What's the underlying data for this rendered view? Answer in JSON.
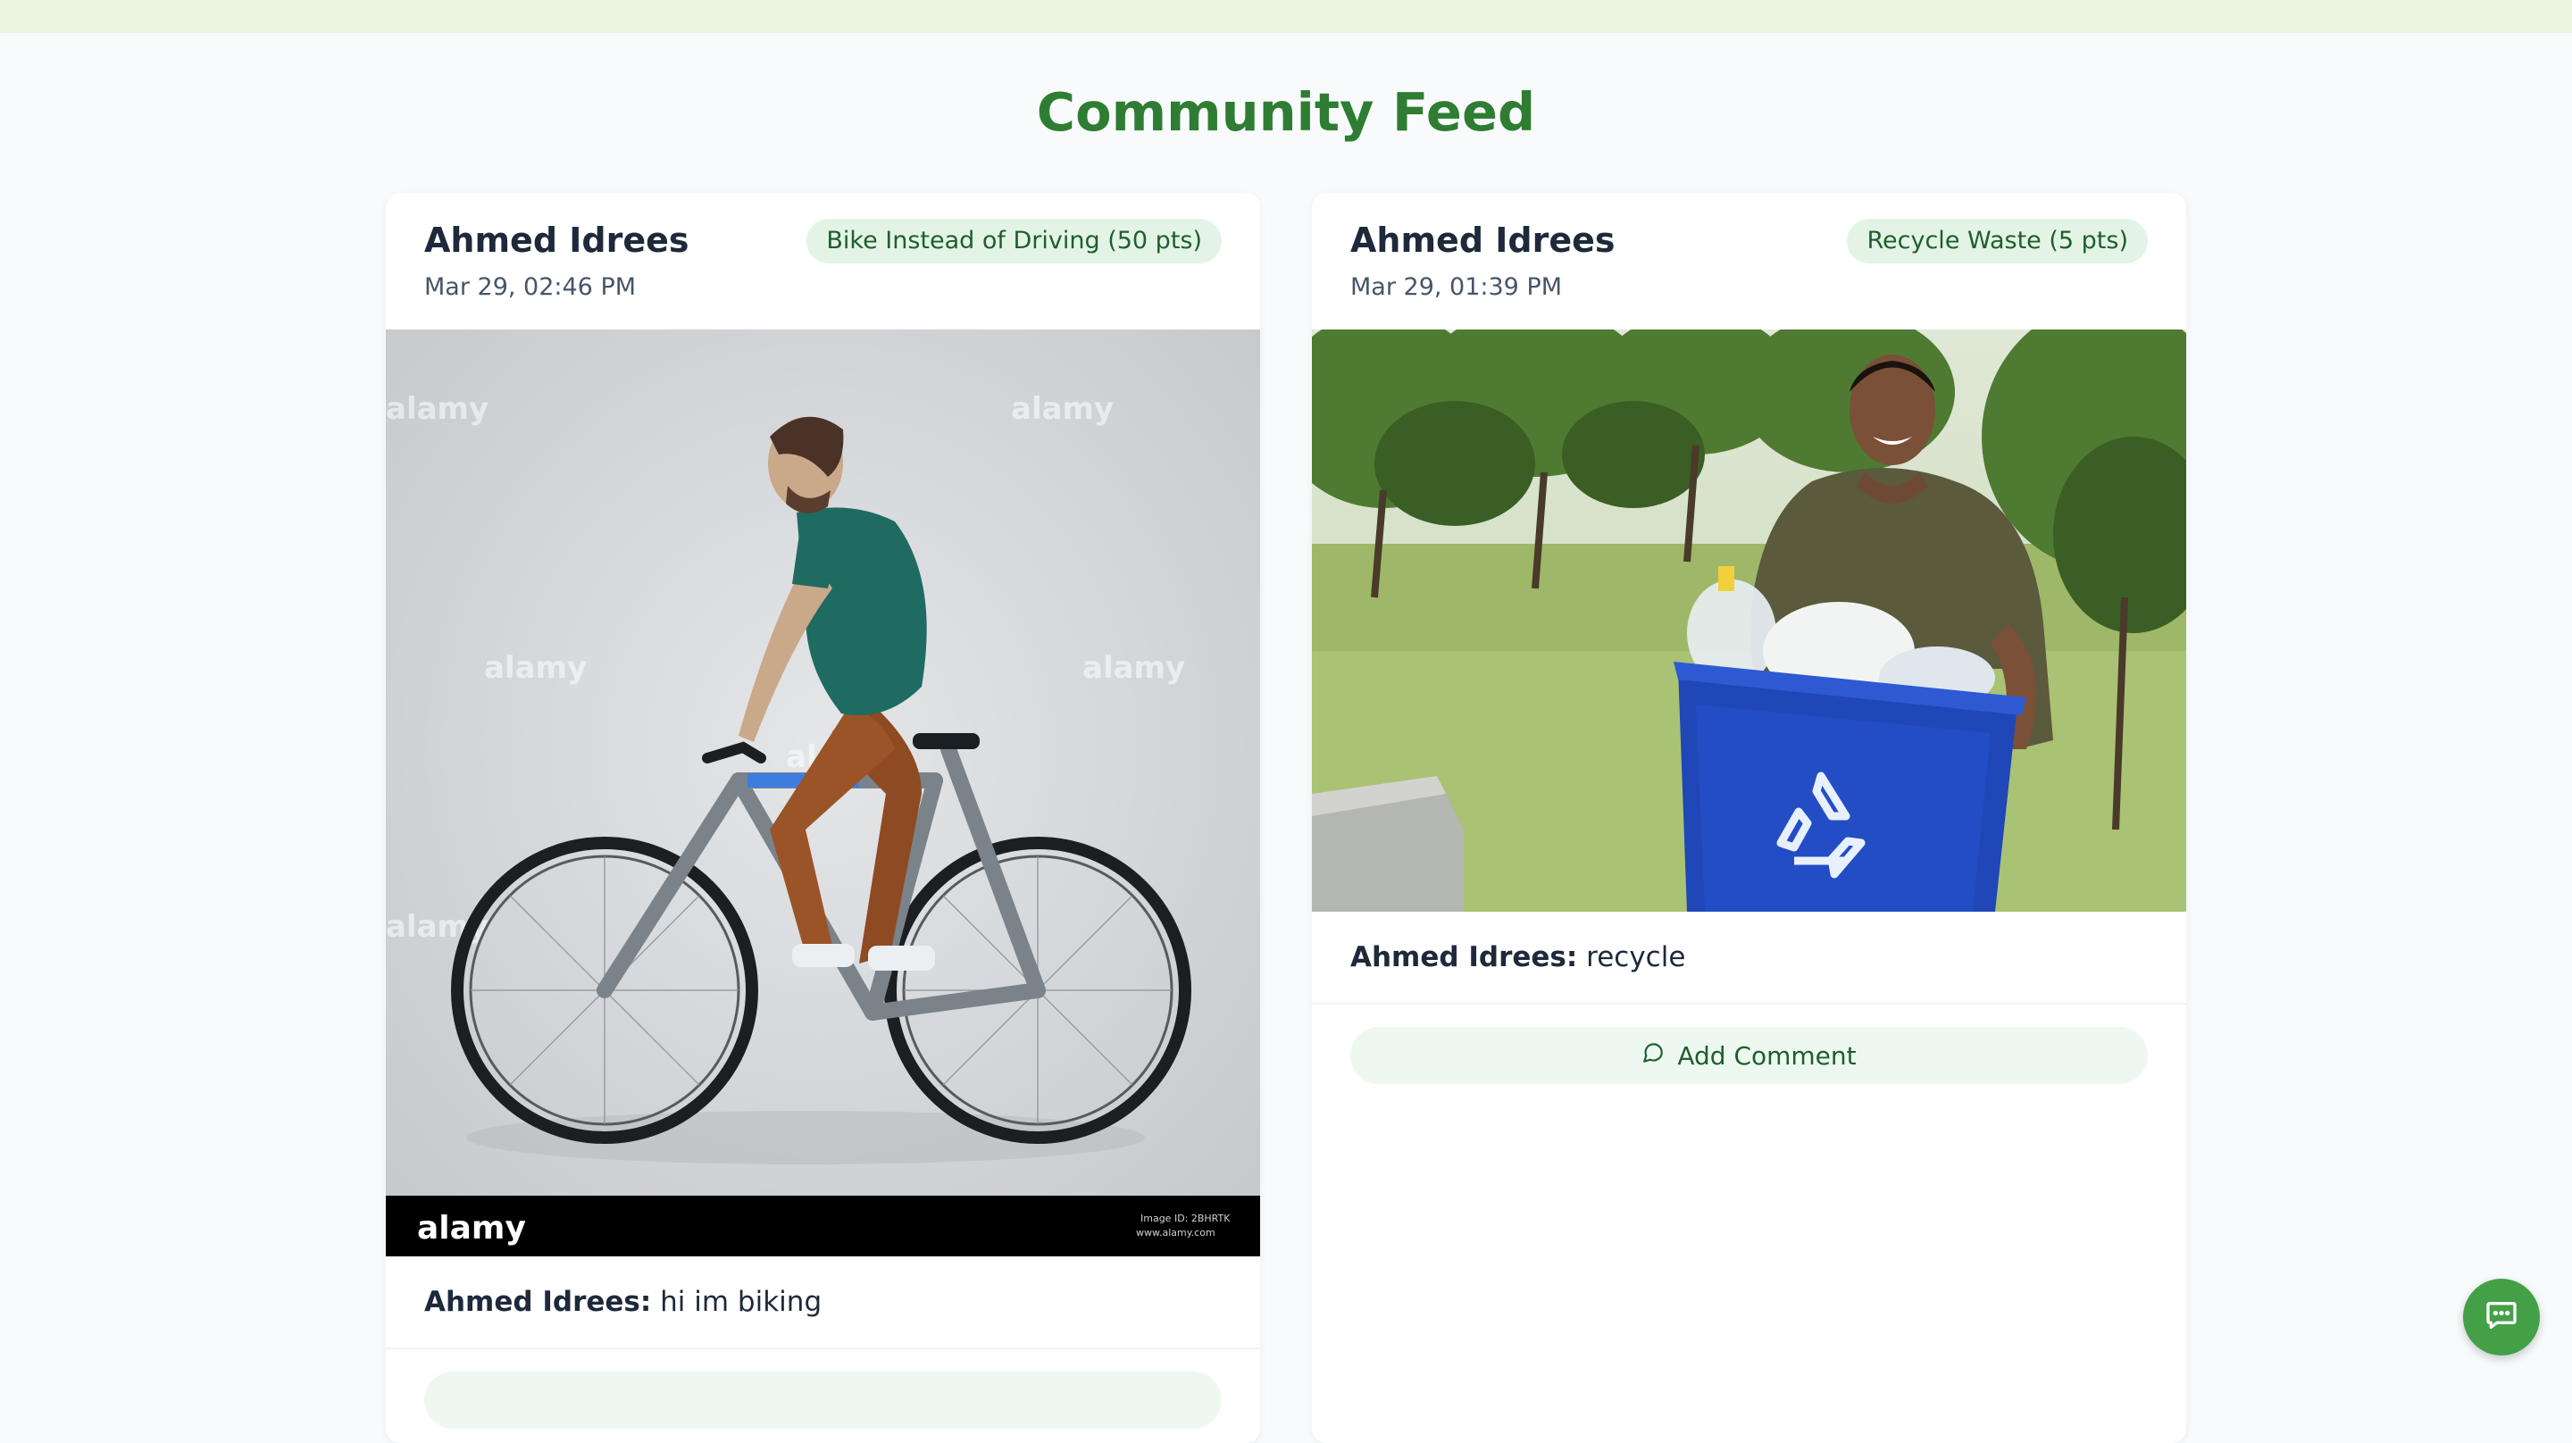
{
  "page": {
    "title": "Community Feed"
  },
  "posts": [
    {
      "author": "Ahmed Idrees",
      "timestamp": "Mar 29, 02:46 PM",
      "badge": "Bike Instead of Driving (50 pts)",
      "caption_author": "Ahmed Idrees:",
      "caption_text": "hi im biking",
      "photo_watermark": "alamy",
      "photo_footer": "Image ID: 2BHRTK",
      "photo_footer_url": "www.alamy.com"
    },
    {
      "author": "Ahmed Idrees",
      "timestamp": "Mar 29, 01:39 PM",
      "badge": "Recycle Waste (5 pts)",
      "caption_author": "Ahmed Idrees:",
      "caption_text": "recycle",
      "comment_button_label": "Add Comment",
      "comment_icon": "comment-bubble-icon"
    }
  ],
  "chat_fab": {
    "icon": "chat-icon"
  },
  "colors": {
    "brand_green": "#2e7d32",
    "badge_bg": "#e3f4e6",
    "fab_bg": "#43a047",
    "top_strip": "#e9f6e2"
  }
}
